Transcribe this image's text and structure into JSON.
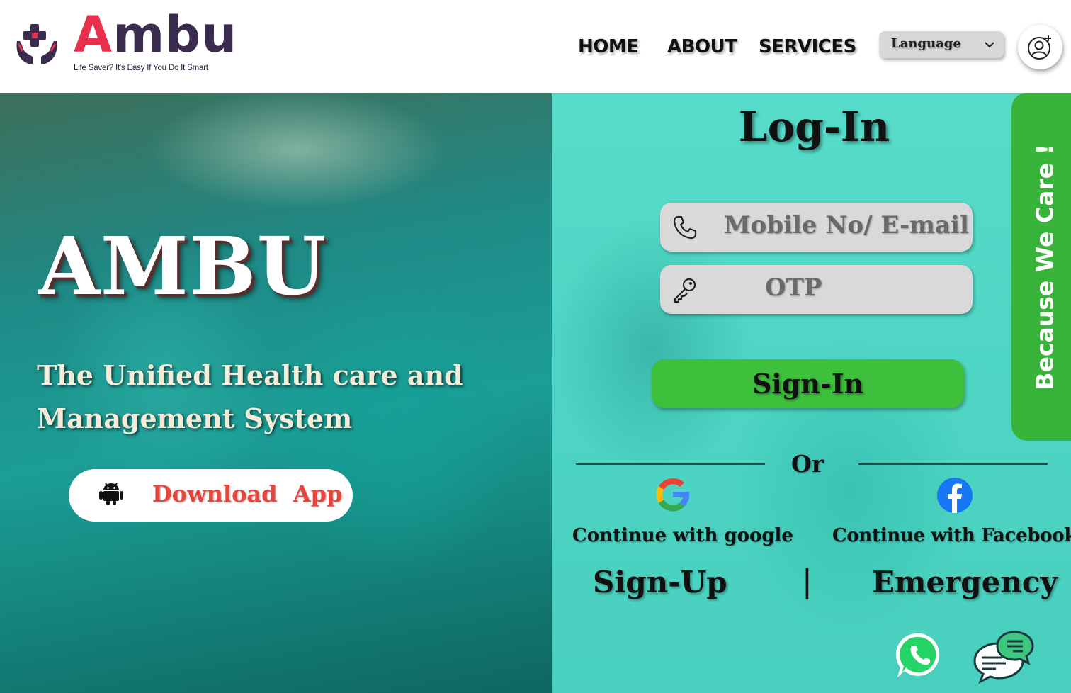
{
  "brand": {
    "name": "Ambu",
    "name_first": "A",
    "name_rest": "mbu",
    "tagline": "Life Saver? It's Easy If You Do It Smart",
    "colors": {
      "primary": "#3a2c4f",
      "accent": "#e8304d"
    }
  },
  "nav": {
    "items": [
      {
        "label": "HOME"
      },
      {
        "label": "ABOUT"
      },
      {
        "label": "SERVICES"
      }
    ],
    "language": {
      "label": "Language",
      "icon": "chevron-down-icon"
    },
    "profile": {
      "icon": "add-user-icon"
    }
  },
  "hero": {
    "title": "AMBU",
    "subtitle": "The Unified Health care and Management System",
    "download": {
      "label": "Download  App",
      "icon": "android-icon"
    }
  },
  "login": {
    "title": "Log-In",
    "mobile": {
      "placeholder": "Mobile No/ E-mail",
      "icon": "phone-icon"
    },
    "otp": {
      "placeholder": "OTP",
      "icon": "key-icon"
    },
    "signin_label": "Sign-In",
    "or_label": "Or",
    "google": {
      "label": "Continue with google",
      "icon": "google-icon"
    },
    "facebook": {
      "label": "Continue with Facebook",
      "icon": "facebook-icon"
    },
    "signup_label": "Sign-Up",
    "separator": "|",
    "emergency_label": "Emergency",
    "side_tab": "Because We Care !",
    "colors": {
      "panel": "#4fd6c4",
      "signin": "#3ec03d",
      "tab": "#38b43b"
    }
  },
  "floating": {
    "whatsapp_icon": "whatsapp-icon",
    "chat_icon": "chat-icon"
  }
}
